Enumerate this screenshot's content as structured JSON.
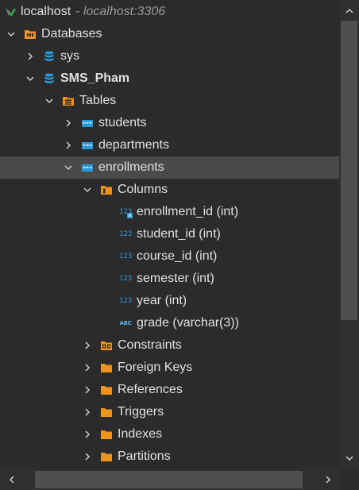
{
  "tree": {
    "connection": {
      "label": "localhost",
      "subtitle": "- localhost:3306"
    },
    "databases": {
      "label": "Databases"
    },
    "sys": {
      "label": "sys"
    },
    "sms_pham": {
      "label": "SMS_Pham"
    },
    "tables": {
      "label": "Tables"
    },
    "students": {
      "label": "students"
    },
    "departments": {
      "label": "departments"
    },
    "enrollments": {
      "label": "enrollments"
    },
    "columns": {
      "label": "Columns"
    },
    "col_enrollment_id": {
      "label": "enrollment_id (int)",
      "icon_text": "123"
    },
    "col_student_id": {
      "label": "student_id (int)",
      "icon_text": "123"
    },
    "col_course_id": {
      "label": "course_id (int)",
      "icon_text": "123"
    },
    "col_semester": {
      "label": "semester (int)",
      "icon_text": "123"
    },
    "col_year": {
      "label": "year (int)",
      "icon_text": "123"
    },
    "col_grade": {
      "label": "grade (varchar(3))",
      "icon_text": "ABC"
    },
    "constraints": {
      "label": "Constraints"
    },
    "foreign_keys": {
      "label": "Foreign Keys"
    },
    "references": {
      "label": "References"
    },
    "triggers": {
      "label": "Triggers"
    },
    "indexes": {
      "label": "Indexes"
    },
    "partitions": {
      "label": "Partitions"
    }
  },
  "icons": {
    "connection": "database-connection-icon",
    "folder": "folder-icon",
    "database": "database-icon",
    "table": "table-icon",
    "column_numeric": "numeric-column-icon",
    "column_text": "text-column-icon"
  },
  "colors": {
    "background": "#2b2b2b",
    "selected_row": "#4a4a4a",
    "folder_orange": "#f0921e",
    "accent_blue": "#2a9bd8",
    "text": "#e0e0e0",
    "muted_text": "#9a9a9a",
    "scrollbar_track": "#2f2f2f",
    "scrollbar_thumb": "#4f4f4f"
  }
}
